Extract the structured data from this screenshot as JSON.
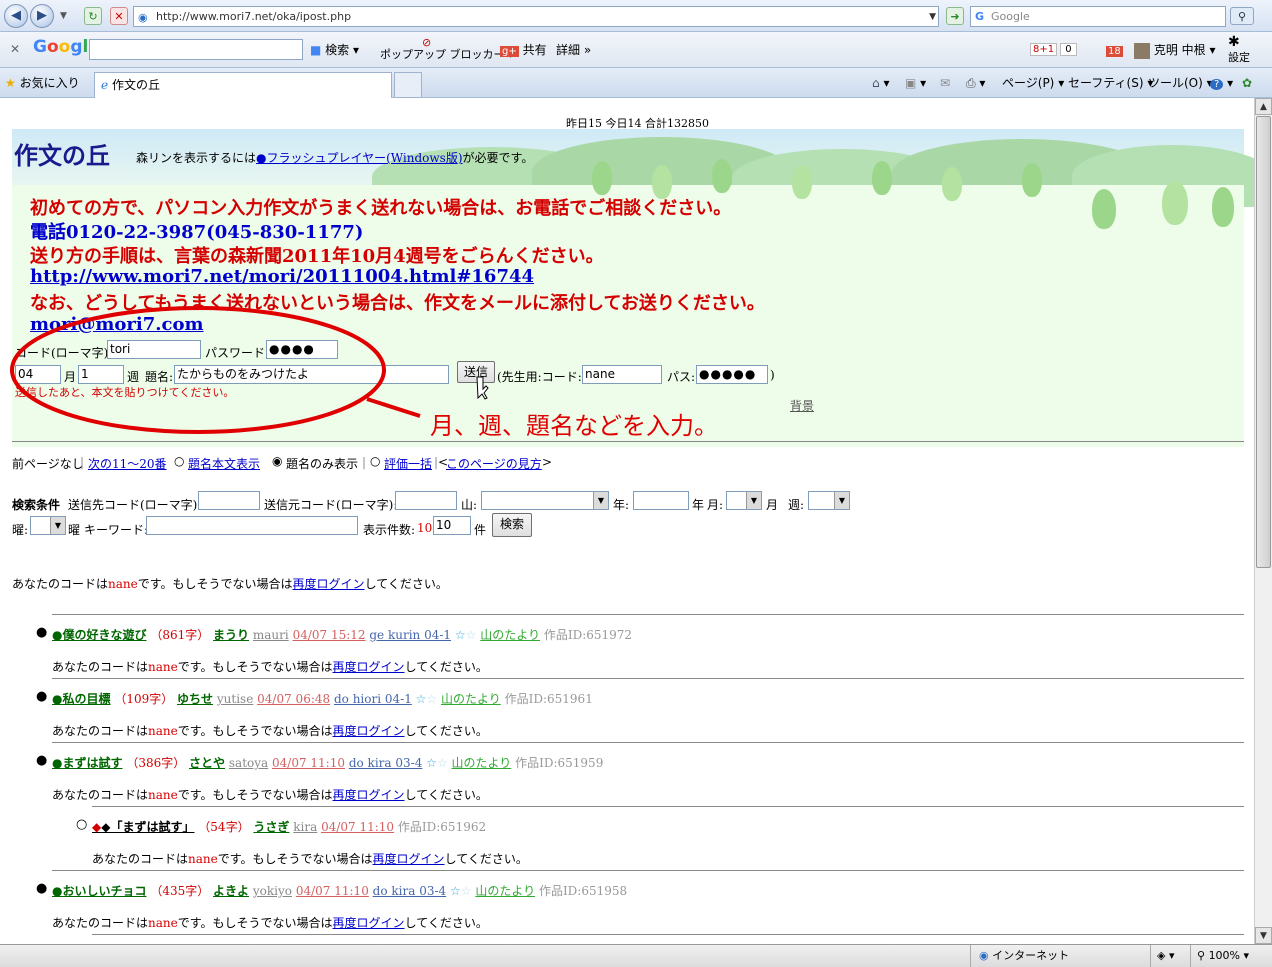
{
  "browser": {
    "url": "http://www.mori7.net/oka/ipost.php",
    "search_placeholder": "Google",
    "toolbar_search": "検索",
    "popup_blocker": "ポップアップ ブロッカー",
    "share": "共有",
    "detail": "詳細",
    "plus_one": "8+1",
    "plus_one_count": "0",
    "notif_count": "18",
    "user_name": "克明 中根",
    "settings": "設定",
    "favorites": "お気に入り",
    "tab_title": "作文の丘",
    "menu_page": "ページ(P)",
    "menu_safety": "セーフティ(S)",
    "menu_tools": "ツール(O)",
    "status_zone": "インターネット",
    "zoom": "100%"
  },
  "page": {
    "counter": "昨日15 今日14 合計132850",
    "title": "作文の丘",
    "flash_note_pre": "森リンを表示するには",
    "flash_link": "●フラッシュプレイヤー(Windows版)",
    "flash_note_post": "が必要です。",
    "notice1": "初めての方で、パソコン入力作文がうまく送れない場合は、お電話でご相談ください。",
    "phone": "電話0120-22-3987(045-830-1177)",
    "notice2": "送り方の手順は、言葉の森新聞2011年10月4週号をごらんください。",
    "link1": "http://www.mori7.net/mori/20111004.html#16744",
    "notice3": "なお、どうしてもうまく送れないという場合は、作文をメールに添付してお送りください。",
    "email": "mori@mori7.com",
    "code_label": "コード(ローマ字):",
    "code_value": "tori",
    "password_label": "パスワード:",
    "password_value": "●●●●",
    "month_value": "04",
    "month_label": "月",
    "week_value": "1",
    "week_label": "週",
    "subject_label": "題名:",
    "subject_value": "たからものをみつけたよ",
    "send_button": "送信",
    "teacher_label": "(先生用:コード:",
    "teacher_code": "nane",
    "pass_label": "パス:",
    "teacher_pass": "●●●●●",
    "close_paren": ")",
    "paste_note": "送信したあと、本文を貼りつけてください。",
    "background_link": "背景",
    "annotation": "月、週、題名などを入力。"
  },
  "nav": {
    "prev": "前ページなし",
    "sep": "|",
    "next": "次の11～20番",
    "opt1": "題名本文表示",
    "opt2": "題名のみ表示",
    "sep2": "|",
    "opt3": "評価一括",
    "sep3": "|",
    "guide_pre": "<",
    "guide": "このページの見方",
    "guide_post": ">"
  },
  "search": {
    "label": "検索条件",
    "to_code": "送信先コード(ローマ字):",
    "from_code": "送信元コード(ローマ字):",
    "mountain": "山:",
    "year": "年:",
    "year_unit": "年",
    "month": "月:",
    "month_unit": "月",
    "week": "週:",
    "weekday": "曜:",
    "weekday_unit": "曜",
    "keyword": "キーワード:",
    "count_label": "表示件数:",
    "count_red": "10",
    "count_value": "10",
    "count_unit": "件",
    "button": "検索"
  },
  "login_note": {
    "pre": "あなたのコードは",
    "code": "nane",
    "mid": "です。もしそうでない場合は",
    "link": "再度ログイン",
    "post": "してください。"
  },
  "items": [
    {
      "title": "●僕の好きな遊び",
      "count": "（861字）",
      "author": "まうり",
      "code": "mauri",
      "date": "04/07 15:12",
      "group": "ge kurin 04-1",
      "yama": "山のたより",
      "id": "作品ID:651972"
    },
    {
      "title": "●私の目標",
      "count": "（109字）",
      "author": "ゆちせ",
      "code": "yutise",
      "date": "04/07 06:48",
      "group": "do hiori 04-1",
      "yama": "山のたより",
      "id": "作品ID:651961"
    },
    {
      "title": "●まずは試す",
      "count": "（386字）",
      "author": "さとや",
      "code": "satoya",
      "date": "04/07 11:10",
      "group": "do kira 03-4",
      "yama": "山のたより",
      "id": "作品ID:651959"
    },
    {
      "title": "●おいしいチョコ",
      "count": "（435字）",
      "author": "よきよ",
      "code": "yokiyo",
      "date": "04/07 11:10",
      "group": "do kira 03-4",
      "yama": "山のたより",
      "id": "作品ID:651958"
    }
  ],
  "reply": {
    "title": "◆「まずは試す」",
    "count": "（54字）",
    "author": "うさぎ",
    "code": "kira",
    "date": "04/07 11:10",
    "id": "作品ID:651962"
  },
  "colors": {
    "accent_red": "#d40000",
    "link_blue": "#0000cc",
    "green": "#006600",
    "banner_bg": "#eefcea",
    "annotation_red": "#e00000"
  }
}
